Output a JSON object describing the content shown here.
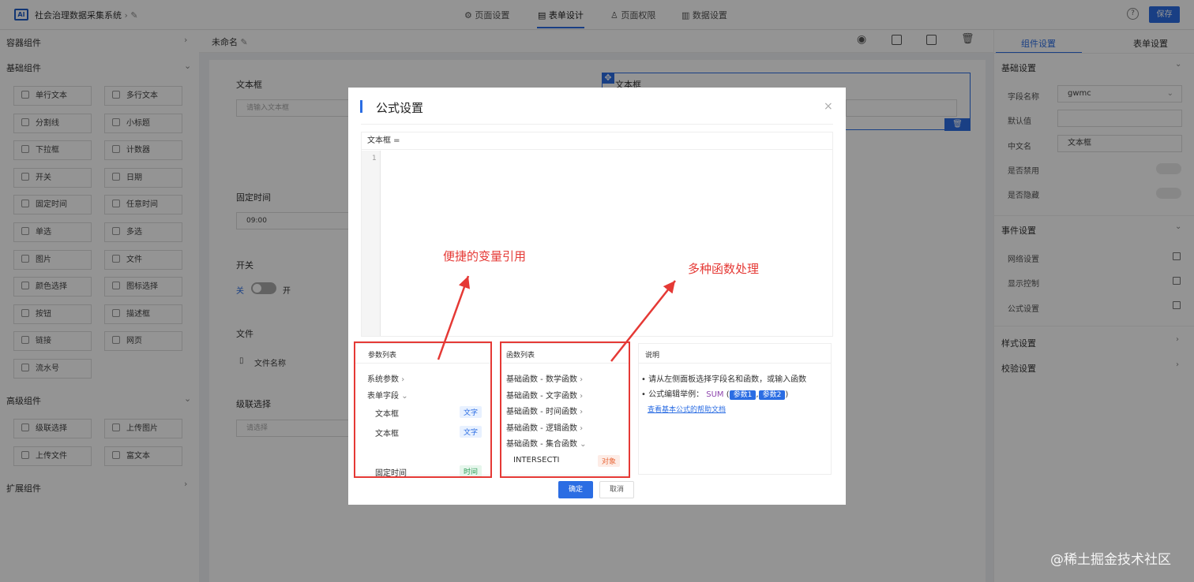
{
  "app": {
    "title": "社会治理数据采集系统",
    "logo": "AI"
  },
  "top_tabs": [
    {
      "label": "页面设置",
      "icon": "gear-icon"
    },
    {
      "label": "表单设计",
      "icon": "document-icon"
    },
    {
      "label": "页面权限",
      "icon": "lock-icon"
    },
    {
      "label": "数据设置",
      "icon": "bar-chart-icon"
    }
  ],
  "header": {
    "help": "?",
    "save_label": "保存"
  },
  "left": {
    "container_title": "容器组件",
    "basic_title": "基础组件",
    "basic_items": [
      "单行文本",
      "多行文本",
      "分割线",
      "小标题",
      "下拉框",
      "计数器",
      "开关",
      "日期",
      "固定时间",
      "任意时间",
      "单选",
      "多选",
      "图片",
      "文件",
      "颜色选择",
      "图标选择",
      "按钮",
      "描述框",
      "链接",
      "网页",
      "流水号"
    ],
    "advanced_title": "高级组件",
    "advanced_items": [
      "级联选择",
      "上传图片",
      "上传文件",
      "富文本"
    ],
    "extension_title": "扩展组件"
  },
  "canvas": {
    "form_name": "未命名",
    "fields": {
      "text_label": "文本框",
      "text_placeholder": "请输入文本框",
      "right_text_label": "文本框",
      "fixed_time_label": "固定时间",
      "fixed_time_value": "09:00",
      "switch_label": "开关",
      "switch_off": "关",
      "switch_on": "开",
      "file_label": "文件",
      "file_name": "文件名称",
      "cascade_label": "级联选择",
      "cascade_placeholder": "请选择"
    }
  },
  "right": {
    "tab_component": "组件设置",
    "tab_form": "表单设置",
    "basic_section": "基础设置",
    "field_name_label": "字段名称",
    "field_name_value": "gwmc",
    "default_label": "默认值",
    "cn_name_label": "中文名",
    "cn_name_value": "文本框",
    "disabled_label": "是否禁用",
    "hidden_label": "是否隐藏",
    "event_section": "事件设置",
    "network_label": "网络设置",
    "display_label": "显示控制",
    "formula_label": "公式设置",
    "style_section": "样式设置",
    "validate_section": "校验设置"
  },
  "modal": {
    "title": "公式设置",
    "close": "×",
    "editor_header": "文本框  =",
    "line_number": "1",
    "params": {
      "title": "参数列表",
      "system": "系统参数",
      "form_fields": "表单字段",
      "items": [
        {
          "label": "文本框",
          "tag": "文字"
        },
        {
          "label": "文本框",
          "tag": "文字"
        },
        {
          "label": "固定时间",
          "tag": "时间"
        }
      ]
    },
    "functions": {
      "title": "函数列表",
      "groups": [
        "基础函数 - 数学函数",
        "基础函数 - 文字函数",
        "基础函数 - 时间函数",
        "基础函数 - 逻辑函数",
        "基础函数 - 集合函数"
      ],
      "item_label": "INTERSECTI",
      "item_tag": "对象"
    },
    "help": {
      "title": "说明",
      "line1": "请从左侧面板选择字段名和函数，或输入函数",
      "line2_prefix": "公式编辑举例：",
      "fn": "SUM",
      "open_paren": "(",
      "arg1": "参数1",
      "comma": ",",
      "arg2": "参数2",
      "close_paren": ")",
      "link": "查看基本公式的帮助文档"
    },
    "confirm": "确定",
    "cancel": "取消"
  },
  "annotations": {
    "left": "便捷的变量引用",
    "right": "多种函数处理"
  },
  "watermark": "@稀土掘金技术社区",
  "colors": {
    "accent": "#2b6de3",
    "annotation": "#e53935",
    "text_tag": "#2b6de3",
    "time_tag": "#2e9d57",
    "object_tag": "#e8693a"
  }
}
